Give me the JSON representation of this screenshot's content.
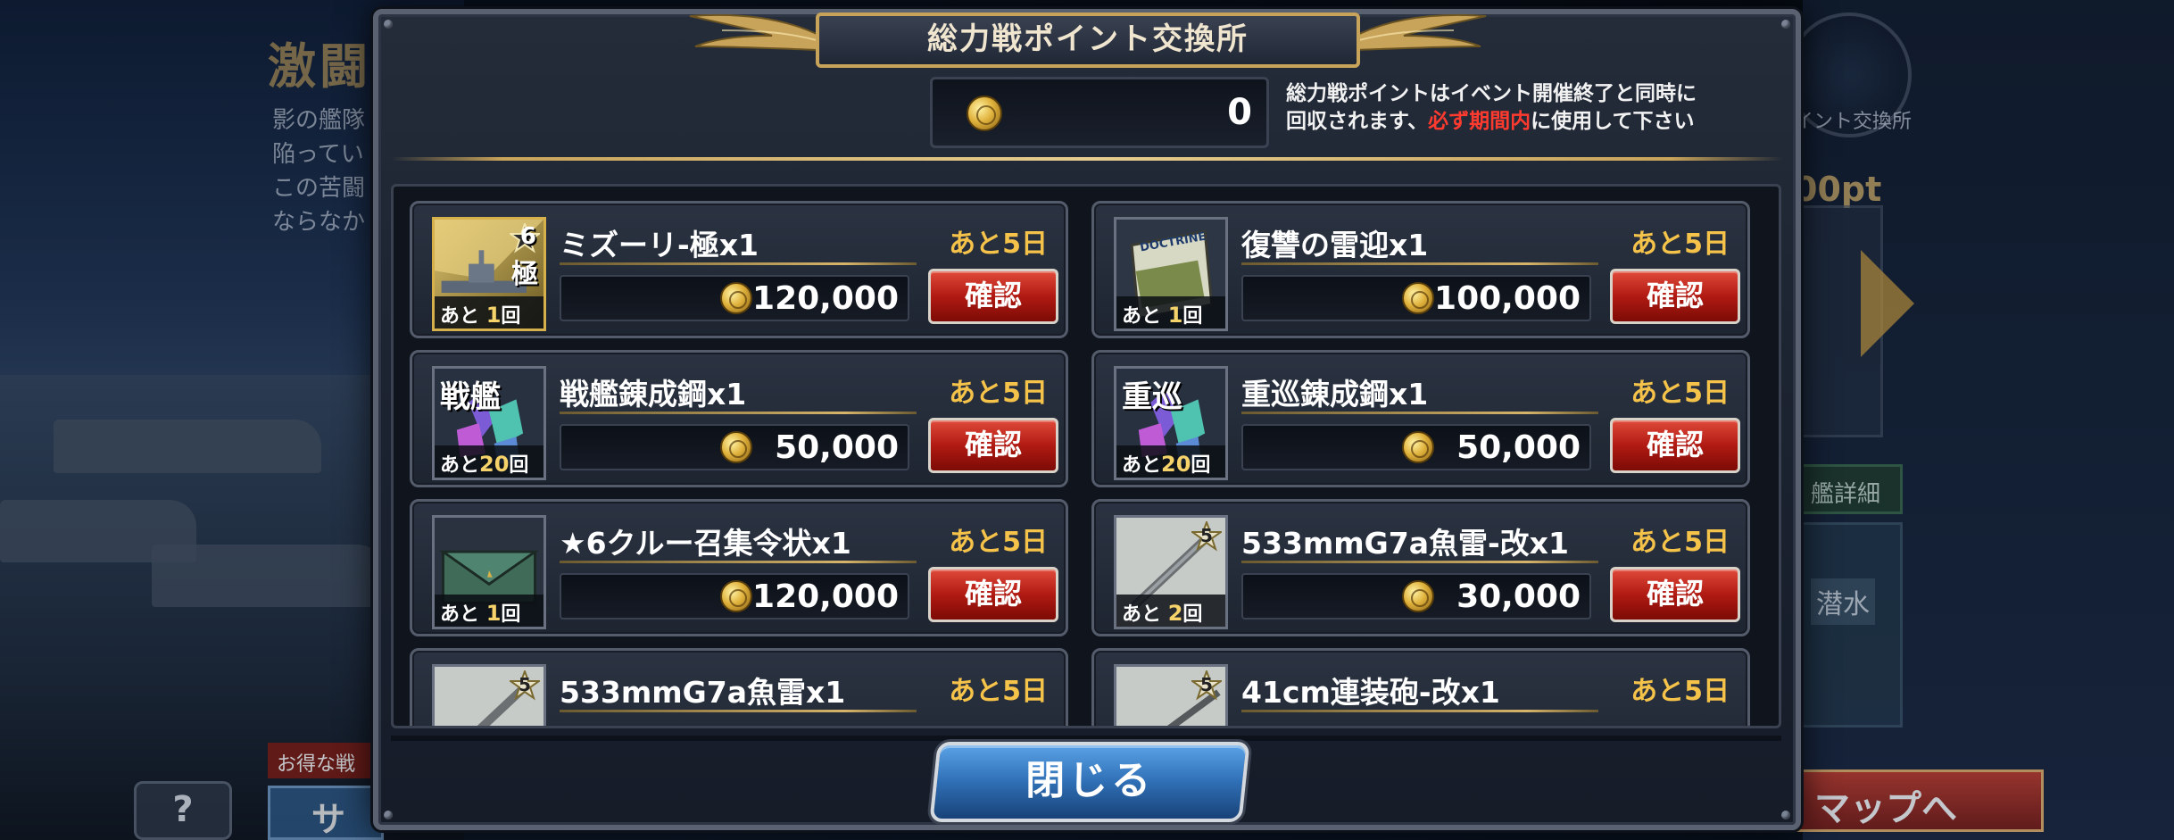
{
  "dialog": {
    "title": "総力戦ポイント交換所",
    "points": "0",
    "notice_line1": "総力戦ポイントはイベント開催終了と同時に",
    "notice_line2_pre": "回収されます、",
    "notice_line2_red": "必ず期間内",
    "notice_line2_post": "に使用して下さい",
    "close_label": "閉じる"
  },
  "items": [
    {
      "name": "ミズーリ-極x1",
      "days": "あと5日",
      "price": "120,000",
      "confirm": "確認",
      "remain_prefix": "あと",
      "remain_num": "1",
      "remain_suffix": "回",
      "thumb_badge": "6",
      "thumb_kanji": "極",
      "thumb_type": "ship"
    },
    {
      "name": "復讐の雷迎x1",
      "days": "あと5日",
      "price": "100,000",
      "confirm": "確認",
      "remain_prefix": "あと",
      "remain_num": "1",
      "remain_suffix": "回",
      "thumb_label": "DOCTRINE",
      "thumb_type": "doctrine"
    },
    {
      "name": "戦艦錬成鋼x1",
      "days": "あと5日",
      "price": "50,000",
      "confirm": "確認",
      "remain_prefix": "あと",
      "remain_num": "20",
      "remain_suffix": "回",
      "thumb_kanji": "戦艦",
      "thumb_type": "steel"
    },
    {
      "name": "重巡錬成鋼x1",
      "days": "あと5日",
      "price": "50,000",
      "confirm": "確認",
      "remain_prefix": "あと",
      "remain_num": "20",
      "remain_suffix": "回",
      "thumb_kanji": "重巡",
      "thumb_type": "steel"
    },
    {
      "name": "★6クルー召集令状x1",
      "days": "あと5日",
      "price": "120,000",
      "confirm": "確認",
      "remain_prefix": "あと",
      "remain_num": "1",
      "remain_suffix": "回",
      "thumb_type": "envelope"
    },
    {
      "name": "533mmG7a魚雷-改x1",
      "days": "あと5日",
      "price": "30,000",
      "confirm": "確認",
      "remain_prefix": "あと",
      "remain_num": "2",
      "remain_suffix": "回",
      "thumb_badge": "5",
      "thumb_type": "torpedo"
    },
    {
      "name": "533mmG7a魚雷x1",
      "days": "あと5日",
      "thumb_badge": "5",
      "thumb_type": "torpedo"
    },
    {
      "name": "41cm連装砲-改x1",
      "days": "あと5日",
      "thumb_badge": "5",
      "thumb_type": "gun"
    }
  ],
  "background": {
    "title": "激闘",
    "text_lines": [
      "影の艦隊",
      "陥ってい",
      "この苦闘",
      "ならなか"
    ],
    "emblem_label": "イント交換所",
    "pt": "00pt",
    "side_btn": "艦詳細",
    "side_card": "潜水",
    "map_btn": "マップへ",
    "help": "?",
    "deal": "お得な戦",
    "sa": "サ"
  },
  "colors": {
    "accent_gold": "#c8a35a",
    "days_text": "#f6c34a",
    "confirm_red": "#b01a12",
    "close_blue": "#2f6fb5",
    "warning_red": "#ff3b2f"
  }
}
